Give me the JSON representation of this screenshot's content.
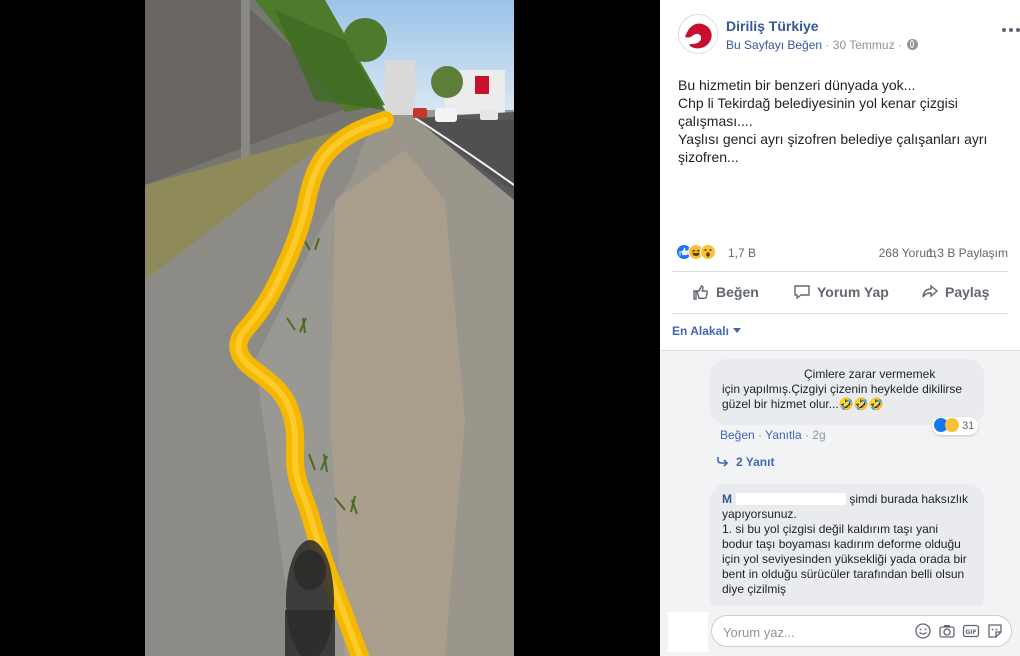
{
  "post": {
    "page_name": "Diriliş Türkiye",
    "like_page": "Bu Sayfayı Beğen",
    "dot": "·",
    "date": "30 Temmuz",
    "text_lines": [
      "Bu hizmetin bir benzeri dünyada yok...",
      "Chp li Tekirdağ belediyesinin yol kenar çizgisi çalışması....",
      "Yaşlısı genci ayrı şizofren belediye çalışanları ayrı şizofren..."
    ],
    "reactions": {
      "icons": [
        "like-icon",
        "haha-icon",
        "wow-icon"
      ],
      "count": "1,7 B"
    },
    "comments_count": "268 Yorum",
    "shares_count": "1,3 B Paylaşım"
  },
  "actions": {
    "like": "Beğen",
    "comment": "Yorum Yap",
    "share": "Paylaş"
  },
  "comments": {
    "sort_label": "En Alakalı",
    "items": [
      {
        "text_line1": "Çimlere zarar vermemek",
        "text_rest": "için yapılmış.Çizgiyi çizenin heykelde dikilirse güzel bir hizmet olur...🤣🤣🤣",
        "reaction_count": "31",
        "like": "Beğen",
        "reply": "Yanıtla",
        "time": "2g",
        "replies": "2 Yanıt"
      },
      {
        "author_initial": "M",
        "text_line1": "şimdi burada haksızlık yapıyorsunuz.",
        "text_rest": "1. si bu yol çizgisi değil kaldırım taşı yani bodur taşı boyaması kadırım deforme olduğu için yol seviyesinden yüksekliği yada orada bir bent in olduğu sürücüler tarafından belli olsun diye çizilmiş"
      }
    ]
  },
  "composer": {
    "placeholder": "Yorum yaz...",
    "icons": [
      "emoji-icon",
      "camera-icon",
      "gif-icon",
      "sticker-icon"
    ]
  },
  "colors": {
    "link": "#365899",
    "accent": "#4267b2",
    "road_line": "#f5b800",
    "like_blue": "#1877f2"
  }
}
